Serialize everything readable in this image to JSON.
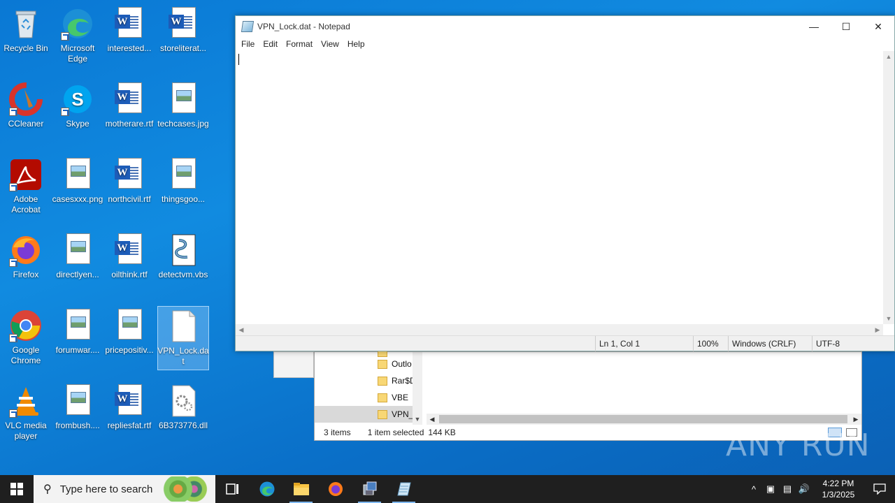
{
  "desktop": {
    "icons": [
      {
        "label": "Recycle Bin",
        "icon": "recycle-bin-icon"
      },
      {
        "label": "Microsoft Edge",
        "icon": "edge-icon"
      },
      {
        "label": "interested...",
        "icon": "word-doc-icon"
      },
      {
        "label": "storeliterat...",
        "icon": "word-doc-icon"
      },
      {
        "label": "CCleaner",
        "icon": "ccleaner-icon"
      },
      {
        "label": "Skype",
        "icon": "skype-icon"
      },
      {
        "label": "motherare.rtf",
        "icon": "word-doc-icon"
      },
      {
        "label": "techcases.jpg",
        "icon": "image-file-icon"
      },
      {
        "label": "Adobe Acrobat",
        "icon": "acrobat-icon"
      },
      {
        "label": "casesxxx.png",
        "icon": "image-file-icon"
      },
      {
        "label": "northcivil.rtf",
        "icon": "word-doc-icon"
      },
      {
        "label": "thingsgoo...",
        "icon": "image-file-icon"
      },
      {
        "label": "Firefox",
        "icon": "firefox-icon"
      },
      {
        "label": "directlyen...",
        "icon": "image-file-icon"
      },
      {
        "label": "oilthink.rtf",
        "icon": "word-doc-icon"
      },
      {
        "label": "detectvm.vbs",
        "icon": "vbs-script-icon"
      },
      {
        "label": "Google Chrome",
        "icon": "chrome-icon"
      },
      {
        "label": "forumwar....",
        "icon": "image-file-icon"
      },
      {
        "label": "pricepositiv...",
        "icon": "image-file-icon"
      },
      {
        "label": "VPN_Lock.dat",
        "icon": "blank-file-icon"
      },
      {
        "label": "VLC media player",
        "icon": "vlc-icon"
      },
      {
        "label": "frombush....",
        "icon": "image-file-icon"
      },
      {
        "label": "repliesfat.rtf",
        "icon": "word-doc-icon"
      },
      {
        "label": "6B373776.dll",
        "icon": "dll-file-icon"
      }
    ]
  },
  "notepad": {
    "title": "VPN_Lock.dat - Notepad",
    "menu": [
      "File",
      "Edit",
      "Format",
      "View",
      "Help"
    ],
    "content": "",
    "status": {
      "position": "Ln 1, Col 1",
      "zoom": "100%",
      "line_ending": "Windows (CRLF)",
      "encoding": "UTF-8"
    }
  },
  "explorer": {
    "tree_items": [
      "Outlo",
      "Rar$D",
      "VBE",
      "VPN_"
    ],
    "status": {
      "items": "3 items",
      "selected": "1 item selected",
      "size": "144 KB"
    }
  },
  "watermark": "ANY RUN",
  "taskbar": {
    "search_placeholder": "Type here to search",
    "clock_time": "4:22 PM",
    "clock_date": "1/3/2025"
  },
  "colors": {
    "desktop_bg": "#0a78d4",
    "taskbar_bg": "#1f1f1f"
  }
}
